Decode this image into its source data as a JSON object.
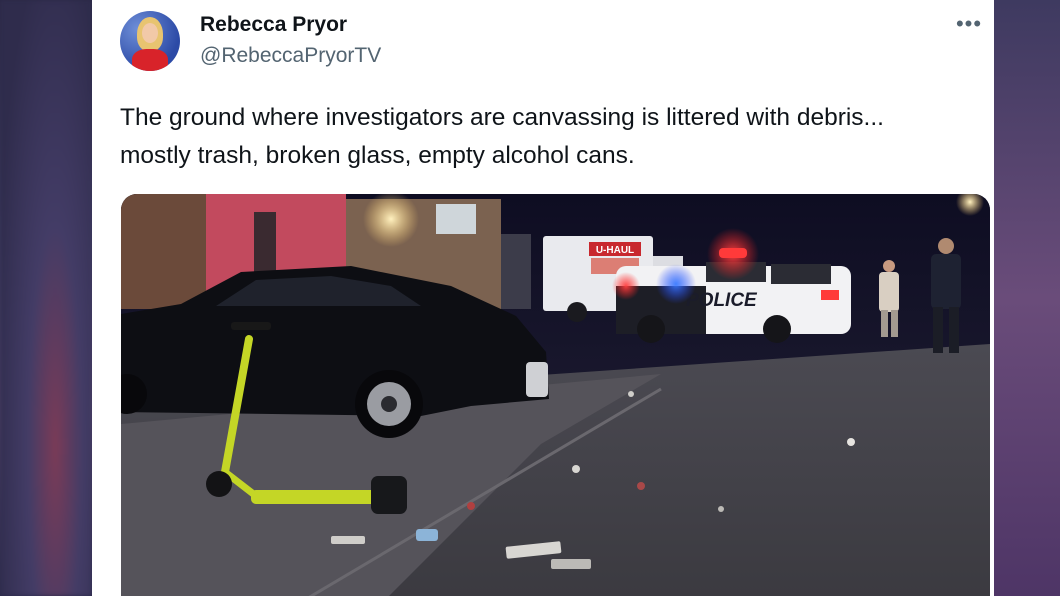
{
  "author": {
    "name": "Rebecca Pryor",
    "handle": "@RebeccaPryorTV"
  },
  "tweet": {
    "line1": "The ground where investigators are canvassing is littered with debris...",
    "line2": "mostly trash, broken glass, empty alcohol cans."
  },
  "media": {
    "truck_text": "U-HAUL",
    "police_text": "POLICE"
  },
  "icons": {
    "more": "more-horizontal-icon",
    "avatar": "profile-photo"
  },
  "colors": {
    "name": "#0f1419",
    "secondary": "#536471",
    "background": "#ffffff"
  }
}
